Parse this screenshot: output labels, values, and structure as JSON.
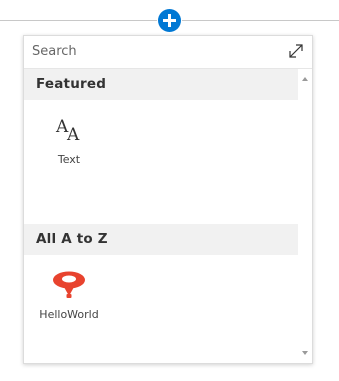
{
  "add_button": {
    "icon": "plus-icon",
    "color": "#0078d4"
  },
  "toolbox": {
    "search": {
      "placeholder": "Search",
      "value": "",
      "expand_icon": "expand-icon"
    },
    "sections": [
      {
        "header": "Featured",
        "items": [
          {
            "label": "Text",
            "icon": "text-icon"
          }
        ]
      },
      {
        "header": "All A to Z",
        "items": [
          {
            "label": "HelloWorld",
            "icon": "balloon-icon",
            "color": "#e8432e"
          }
        ]
      }
    ]
  }
}
